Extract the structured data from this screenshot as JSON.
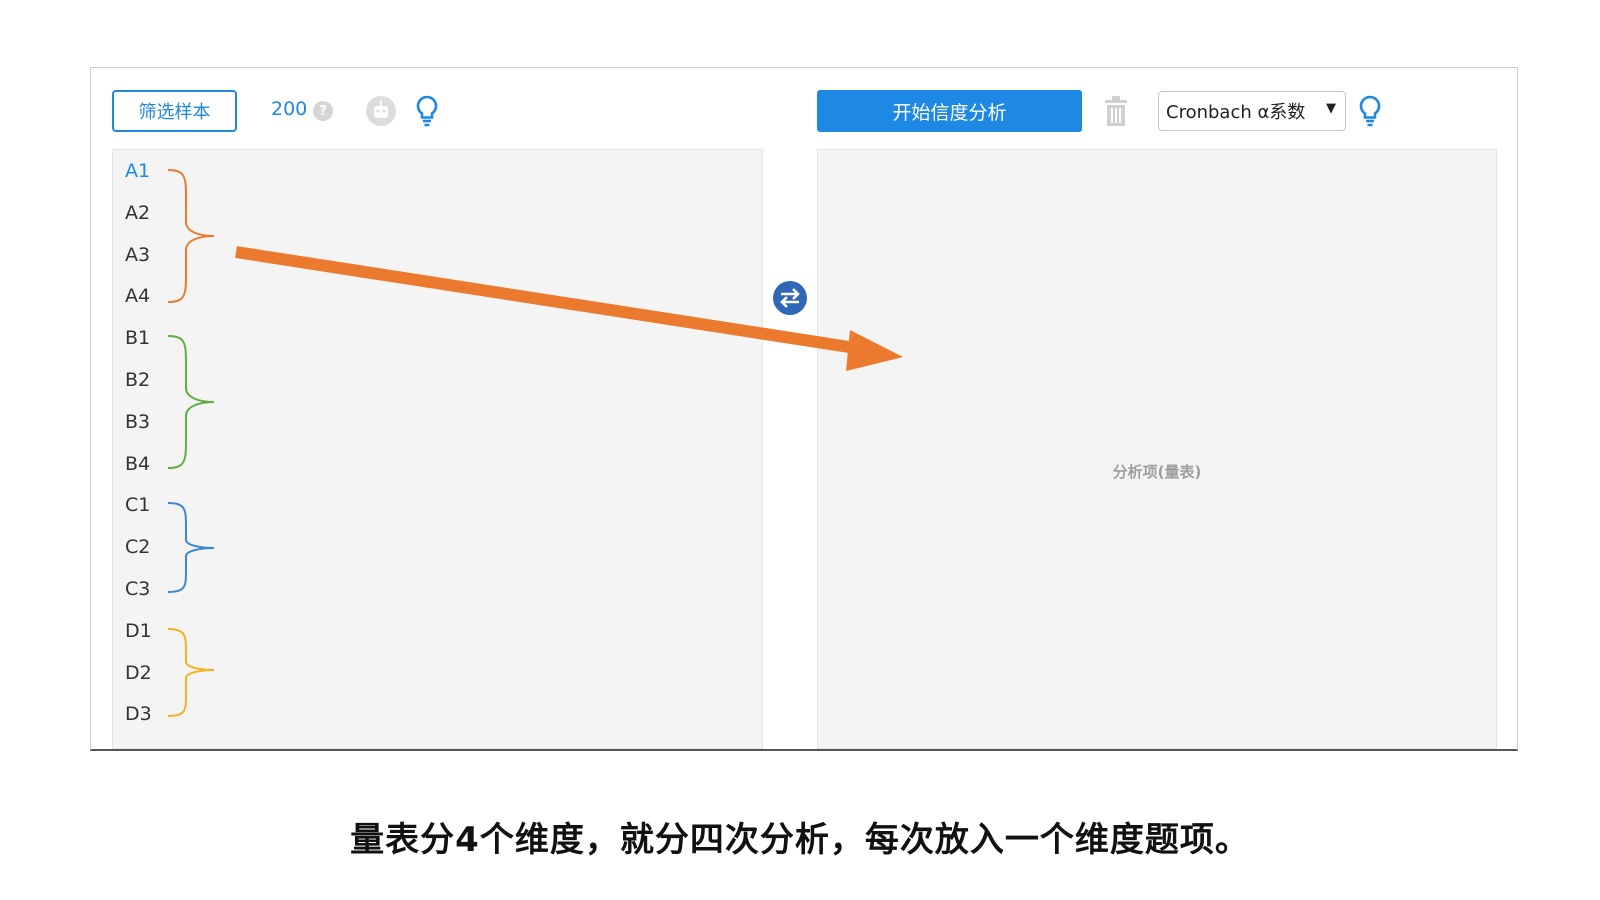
{
  "toolbar": {
    "filter_label": "筛选样本",
    "sample_count": "200",
    "help_glyph": "?",
    "start_label": "开始信度分析",
    "method_value": "Cronbach α系数",
    "method_caret": "▼"
  },
  "variables": [
    "A1",
    "A2",
    "A3",
    "A4",
    "B1",
    "B2",
    "B3",
    "B4",
    "C1",
    "C2",
    "C3",
    "D1",
    "D2",
    "D3"
  ],
  "active_variable": "A1",
  "analysis_panel": {
    "placeholder": "分析项(量表)"
  },
  "annotations": {
    "bracket_colors": {
      "A": "#ec7a2e",
      "B": "#5cae45",
      "C": "#3f88d0",
      "D": "#f3b21e"
    },
    "arrow_color": "#ec7a2e"
  },
  "caption": "量表分4个维度，就分四次分析，每次放入一个维度题项。",
  "colors": {
    "accent": "#1e88e5",
    "panel_bg": "#f4f4f4",
    "swap_icon": "#2f66b8"
  },
  "icons": [
    "help-icon",
    "robot-icon",
    "lightbulb-icon",
    "trash-icon",
    "swap-arrows-icon",
    "chevron-down-icon"
  ]
}
